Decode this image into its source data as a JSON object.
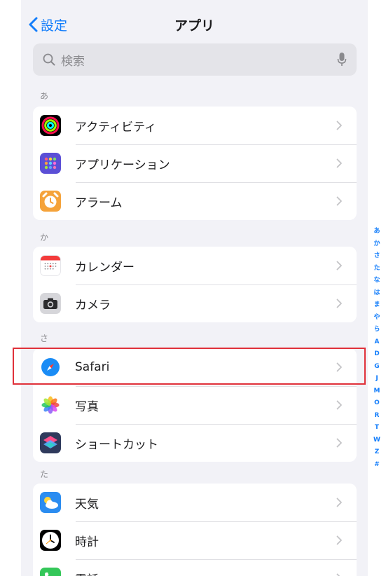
{
  "nav": {
    "back_label": "設定",
    "title": "アプリ"
  },
  "search": {
    "placeholder": "検索"
  },
  "sections": [
    {
      "header": "あ",
      "items": [
        {
          "label": "アクティビティ",
          "icon": "activity-icon"
        },
        {
          "label": "アプリケーション",
          "icon": "apps-icon"
        },
        {
          "label": "アラーム",
          "icon": "alarm-icon"
        }
      ]
    },
    {
      "header": "か",
      "items": [
        {
          "label": "カレンダー",
          "icon": "calendar-icon"
        },
        {
          "label": "カメラ",
          "icon": "camera-icon"
        }
      ]
    },
    {
      "header": "さ",
      "items": [
        {
          "label": "Safari",
          "icon": "safari-icon",
          "highlighted": true
        },
        {
          "label": "写真",
          "icon": "photos-icon"
        },
        {
          "label": "ショートカット",
          "icon": "shortcuts-icon"
        }
      ]
    },
    {
      "header": "た",
      "items": [
        {
          "label": "天気",
          "icon": "weather-icon"
        },
        {
          "label": "時計",
          "icon": "clock-icon"
        },
        {
          "label": "電話",
          "icon": "phone-icon"
        }
      ]
    }
  ],
  "index": [
    "あ",
    "か",
    "さ",
    "た",
    "な",
    "は",
    "ま",
    "や",
    "ら",
    "A",
    "D",
    "G",
    "J",
    "M",
    "O",
    "R",
    "T",
    "W",
    "Z",
    "#"
  ],
  "colors": {
    "accent": "#147efb",
    "highlight": "#e0313a",
    "background": "#f2f2f7"
  }
}
